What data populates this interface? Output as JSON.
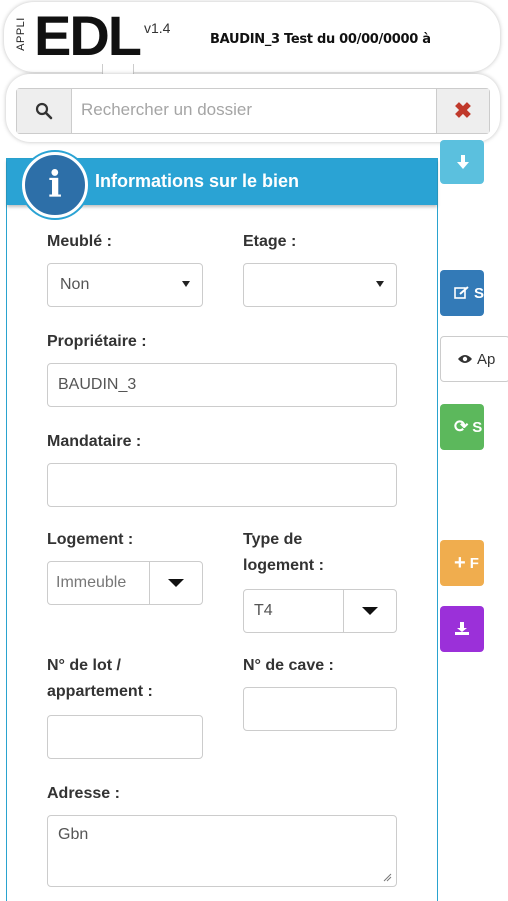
{
  "header": {
    "logo_prefix": "APPLI",
    "logo": "EDL",
    "version": "v1.4",
    "title": "BAUDIN_3 Test du 00/00/0000 à"
  },
  "search": {
    "placeholder": "Rechercher un dossier",
    "icon": "search-icon",
    "clear_icon": "close-icon",
    "clear_color": "#c0392b"
  },
  "panel": {
    "title": "Informations sur le bien",
    "icon": "info-icon",
    "header_color": "#2aa3d4"
  },
  "form": {
    "meuble_label": "Meublé :",
    "meuble_value": "Non",
    "etage_label": "Etage :",
    "etage_value": "",
    "proprietaire_label": "Propriétaire :",
    "proprietaire_value": "BAUDIN_3",
    "mandataire_label": "Mandataire :",
    "mandataire_value": "",
    "logement_label": "Logement :",
    "logement_value": "Immeuble",
    "type_logement_label_1": "Type de",
    "type_logement_label_2": "logement :",
    "type_logement_value": "T4",
    "lot_label_1": "N° de lot /",
    "lot_label_2": "appartement :",
    "lot_value": "",
    "cave_label": "N° de cave :",
    "cave_value": "",
    "adresse_label": "Adresse :",
    "adresse_value": "Gbn"
  },
  "side_buttons": [
    {
      "icon": "arrow-down-icon",
      "label": "",
      "color": "#5bc0de"
    },
    {
      "icon": "edit-icon",
      "label": "S",
      "color": "#337ab7"
    },
    {
      "icon": "eye-icon",
      "label": "Ap",
      "color": "#ffffff"
    },
    {
      "icon": "refresh-icon",
      "label": "S",
      "color": "#5cb85c"
    },
    {
      "icon": "plus-icon",
      "label": "F",
      "color": "#f0ad4e"
    },
    {
      "icon": "download-icon",
      "label": "",
      "color": "#9b30d9"
    }
  ]
}
